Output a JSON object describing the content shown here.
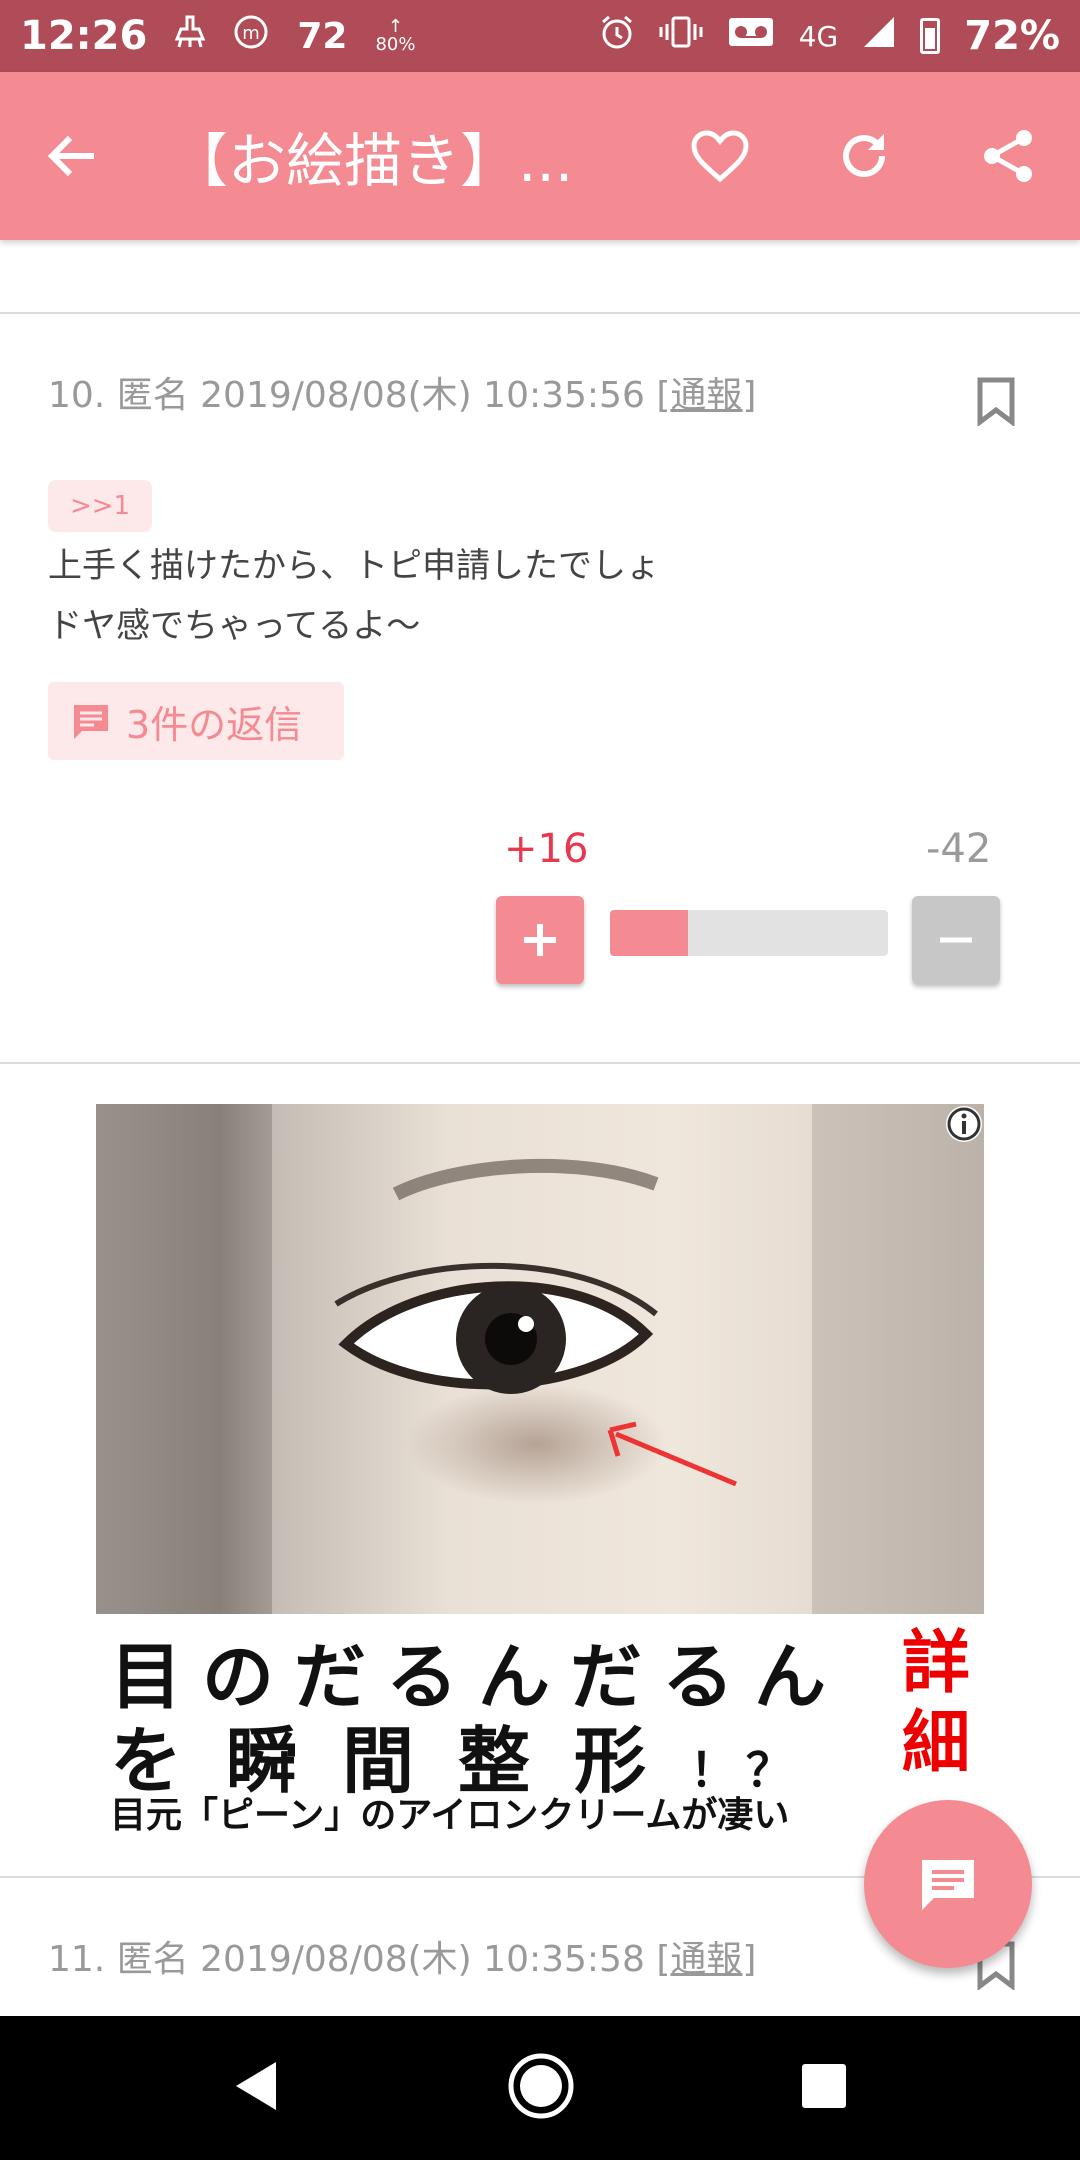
{
  "status_bar": {
    "time": "12:26",
    "notif_number": "72",
    "upload_percent": "80%",
    "network": "4G",
    "battery": "72%"
  },
  "app_bar": {
    "title": "【お絵描き】...",
    "icons": [
      "back-arrow-icon",
      "heart-icon",
      "refresh-icon",
      "share-icon"
    ]
  },
  "posts": [
    {
      "meta": "10. 匿名 2019/08/08(木) 10:35:56",
      "report": "[通報]",
      "anchor": ">>1",
      "body_lines": [
        "上手く描けたから、トピ申請したでしょ",
        "ドヤ感でちゃってるよ〜"
      ],
      "replies_label": "3件の返信",
      "vote_plus": "+16",
      "vote_minus": "-42",
      "vote_ratio": 0.28,
      "plus_button": "+",
      "minus_button": "−"
    },
    {
      "meta": "11. 匿名 2019/08/08(木) 10:35:58",
      "report": "[通報]"
    }
  ],
  "ad": {
    "line1": "目のだるんだるん",
    "line2_main": "を瞬間整形",
    "line2_small": "！？",
    "line3": "目元「ピーン」のアイロンクリームが凄い",
    "cta": "詳細"
  },
  "colors": {
    "status_bar": "#b04c57",
    "app_bar": "#f48a92",
    "accent_red": "#e8384f",
    "tag_bg": "#fde8ea"
  }
}
